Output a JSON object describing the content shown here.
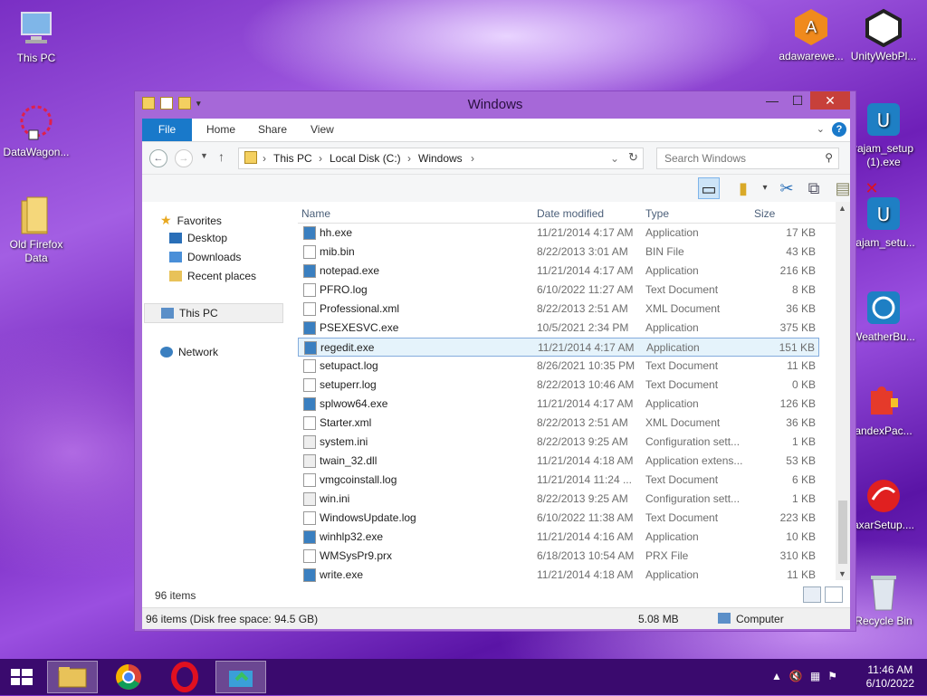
{
  "desktop": {
    "left": [
      {
        "label": "This PC",
        "icon": "computer-icon"
      },
      {
        "label": "DataWagon...",
        "icon": "datawagon-icon"
      },
      {
        "label": "Old Firefox Data",
        "icon": "folder-icon"
      }
    ],
    "right": [
      {
        "label": "adawarewe...",
        "icon": "adaware-icon"
      },
      {
        "label": "UnityWebPl...",
        "icon": "unity-icon"
      },
      {
        "label": "rajam_setup (1).exe",
        "icon": "setup-icon"
      },
      {
        "label": "rajam_setu...",
        "icon": "setup-icon"
      },
      {
        "label": "WeatherBu...",
        "icon": "weather-icon"
      },
      {
        "label": "andexPac...",
        "icon": "puzzle-icon"
      },
      {
        "label": "axarSetup....",
        "icon": "setup-red-icon"
      },
      {
        "label": "Recycle Bin",
        "icon": "recycle-bin-icon"
      }
    ]
  },
  "window": {
    "title": "Windows",
    "tabs": {
      "file": "File",
      "home": "Home",
      "share": "Share",
      "view": "View"
    },
    "address": {
      "seg1": "This PC",
      "seg2": "Local Disk (C:)",
      "seg3": "Windows"
    },
    "search_placeholder": "Search Windows",
    "nav": {
      "favorites": "Favorites",
      "desktop": "Desktop",
      "downloads": "Downloads",
      "recent": "Recent places",
      "thispc": "This PC",
      "network": "Network"
    },
    "columns": {
      "name": "Name",
      "date": "Date modified",
      "type": "Type",
      "size": "Size"
    },
    "files": [
      {
        "name": "hh.exe",
        "date": "11/21/2014 4:17 AM",
        "type": "Application",
        "size": "17 KB"
      },
      {
        "name": "mib.bin",
        "date": "8/22/2013 3:01 AM",
        "type": "BIN File",
        "size": "43 KB"
      },
      {
        "name": "notepad.exe",
        "date": "11/21/2014 4:17 AM",
        "type": "Application",
        "size": "216 KB"
      },
      {
        "name": "PFRO.log",
        "date": "6/10/2022 11:27 AM",
        "type": "Text Document",
        "size": "8 KB"
      },
      {
        "name": "Professional.xml",
        "date": "8/22/2013 2:51 AM",
        "type": "XML Document",
        "size": "36 KB"
      },
      {
        "name": "PSEXESVC.exe",
        "date": "10/5/2021 2:34 PM",
        "type": "Application",
        "size": "375 KB"
      },
      {
        "name": "regedit.exe",
        "date": "11/21/2014 4:17 AM",
        "type": "Application",
        "size": "151 KB"
      },
      {
        "name": "setupact.log",
        "date": "8/26/2021 10:35 PM",
        "type": "Text Document",
        "size": "11 KB"
      },
      {
        "name": "setuperr.log",
        "date": "8/22/2013 10:46 AM",
        "type": "Text Document",
        "size": "0 KB"
      },
      {
        "name": "splwow64.exe",
        "date": "11/21/2014 4:17 AM",
        "type": "Application",
        "size": "126 KB"
      },
      {
        "name": "Starter.xml",
        "date": "8/22/2013 2:51 AM",
        "type": "XML Document",
        "size": "36 KB"
      },
      {
        "name": "system.ini",
        "date": "8/22/2013 9:25 AM",
        "type": "Configuration sett...",
        "size": "1 KB"
      },
      {
        "name": "twain_32.dll",
        "date": "11/21/2014 4:18 AM",
        "type": "Application extens...",
        "size": "53 KB"
      },
      {
        "name": "vmgcoinstall.log",
        "date": "11/21/2014 11:24 ...",
        "type": "Text Document",
        "size": "6 KB"
      },
      {
        "name": "win.ini",
        "date": "8/22/2013 9:25 AM",
        "type": "Configuration sett...",
        "size": "1 KB"
      },
      {
        "name": "WindowsUpdate.log",
        "date": "6/10/2022 11:38 AM",
        "type": "Text Document",
        "size": "223 KB"
      },
      {
        "name": "winhlp32.exe",
        "date": "11/21/2014 4:16 AM",
        "type": "Application",
        "size": "10 KB"
      },
      {
        "name": "WMSysPr9.prx",
        "date": "6/18/2013 10:54 AM",
        "type": "PRX File",
        "size": "310 KB"
      },
      {
        "name": "write.exe",
        "date": "11/21/2014 4:18 AM",
        "type": "Application",
        "size": "11 KB"
      }
    ],
    "item_count": "96 items",
    "status": {
      "info": "96 items (Disk free space: 94.5 GB)",
      "size": "5.08 MB",
      "location": "Computer"
    }
  },
  "tray": {
    "time": "11:46 AM",
    "date": "6/10/2022"
  }
}
